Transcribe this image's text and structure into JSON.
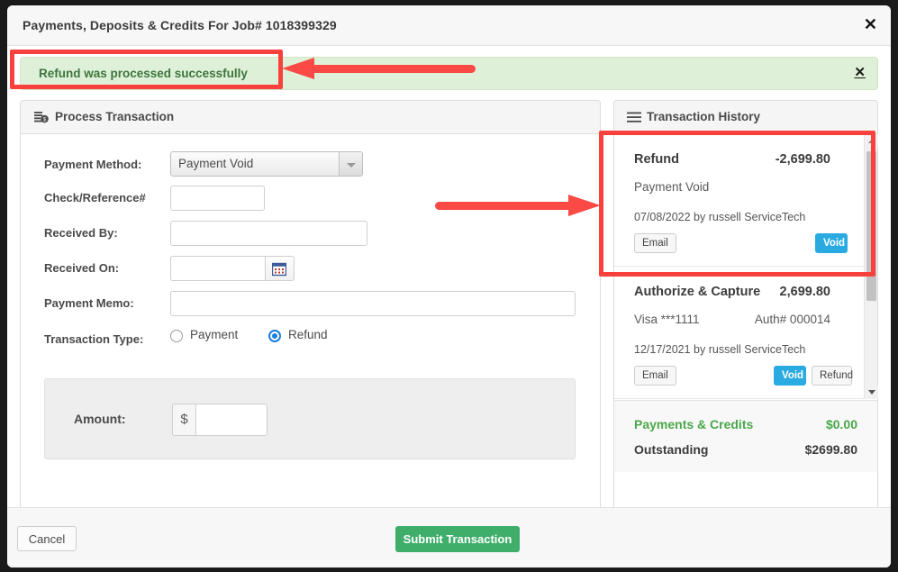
{
  "window": {
    "title": "Payments, Deposits & Credits For Job# 1018399329",
    "close_icon": "close-icon",
    "close_glyph": "✕"
  },
  "alert": {
    "message": "Refund was processed successfully",
    "close_glyph": "✕",
    "background_color": "#dff0d8",
    "text_color": "#3c763d"
  },
  "process_panel": {
    "icon": "money-stack-icon",
    "title": "Process Transaction",
    "fields": {
      "payment_method": {
        "label": "Payment Method:",
        "value": "Payment Void",
        "caret_icon": "chevron-down-icon"
      },
      "check_reference": {
        "label": "Check/Reference#",
        "value": "",
        "placeholder": ""
      },
      "received_by": {
        "label": "Received By:",
        "value": "",
        "placeholder": ""
      },
      "received_on": {
        "label": "Received On:",
        "value": "",
        "placeholder": "",
        "calendar_icon": "calendar-icon"
      },
      "payment_memo": {
        "label": "Payment Memo:",
        "value": "",
        "placeholder": ""
      },
      "transaction_type": {
        "label": "Transaction Type:",
        "options": [
          "Payment",
          "Refund"
        ],
        "selected": "Refund"
      },
      "amount": {
        "label": "Amount:",
        "currency_symbol": "$",
        "value": "",
        "placeholder": ""
      }
    }
  },
  "transaction_history": {
    "icon": "list-bars-icon",
    "title": "Transaction History",
    "transactions": [
      {
        "type": "Refund",
        "amount": "-2,699.80",
        "method": "Payment Void",
        "method_right": "",
        "meta": "07/08/2022 by russell ServiceTech",
        "buttons": [
          "Email",
          "Void"
        ]
      },
      {
        "type": "Authorize & Capture",
        "amount": "2,699.80",
        "method": "Visa ***1111",
        "method_right": "Auth# 000014",
        "meta": "12/17/2021 by russell ServiceTech",
        "buttons": [
          "Email",
          "Void",
          "Refund"
        ]
      }
    ],
    "scrollbar": {
      "up_icon": "scroll-up-arrow-icon",
      "down_icon": "scroll-down-arrow-icon"
    },
    "totals": [
      {
        "label": "Payments & Credits",
        "value": "$0.00",
        "color": "#4aa84a"
      },
      {
        "label": "Outstanding",
        "value": "$2699.80",
        "color": "#3c3c3c"
      }
    ]
  },
  "footer": {
    "cancel_label": "Cancel",
    "submit_label": "Submit Transaction",
    "submit_color": "#3fae6b"
  },
  "annotations": {
    "color": "#f8413c",
    "highlight_alert": true,
    "highlight_refund_transaction": true,
    "arrows": 2
  }
}
